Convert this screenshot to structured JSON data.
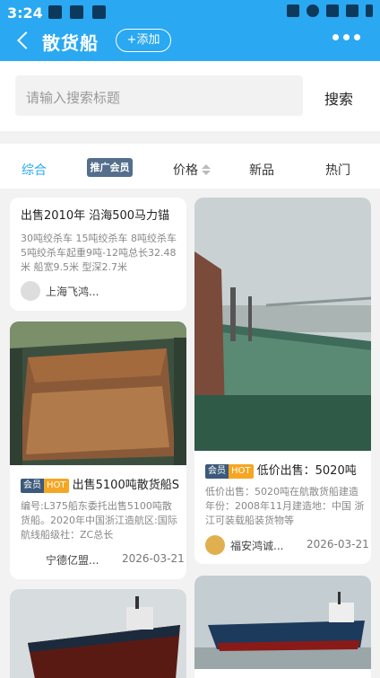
{
  "status": {
    "time": "3:24"
  },
  "header": {
    "title": "散货船",
    "add_label": "+添加"
  },
  "search": {
    "placeholder": "请输入搜索标题",
    "button": "搜索"
  },
  "tabs": {
    "all": "综合",
    "promo": "推广会员",
    "price": "价格",
    "new": "新品",
    "hot": "热门"
  },
  "badges": {
    "vip": "会员",
    "hot": "HOT"
  },
  "cards": [
    {
      "title": "出售2010年 沿海500马力锚",
      "desc": "30吨绞杀车 15吨绞杀车 8吨绞杀车 5吨绞杀车起重9吨-12吨总长32.48米 船宽9.5米 型深2.7米",
      "company": "上海飞鸿...",
      "date": ""
    },
    {
      "title": "出售5100吨散货船S",
      "desc": "编号:L375船东委托出售5100吨散货船。2020年中国浙江造航区:国际航线船级社：ZC总长",
      "company": "宁德亿盟...",
      "date": "2026-03-21"
    },
    {
      "title": "低价出售：5020吨",
      "desc": "低价出售：5020吨在航散货船建造年份：2008年11月建造地：中国 浙江可装载船装货物等",
      "company": "福安鸿诚...",
      "date": "2026-03-21"
    }
  ]
}
